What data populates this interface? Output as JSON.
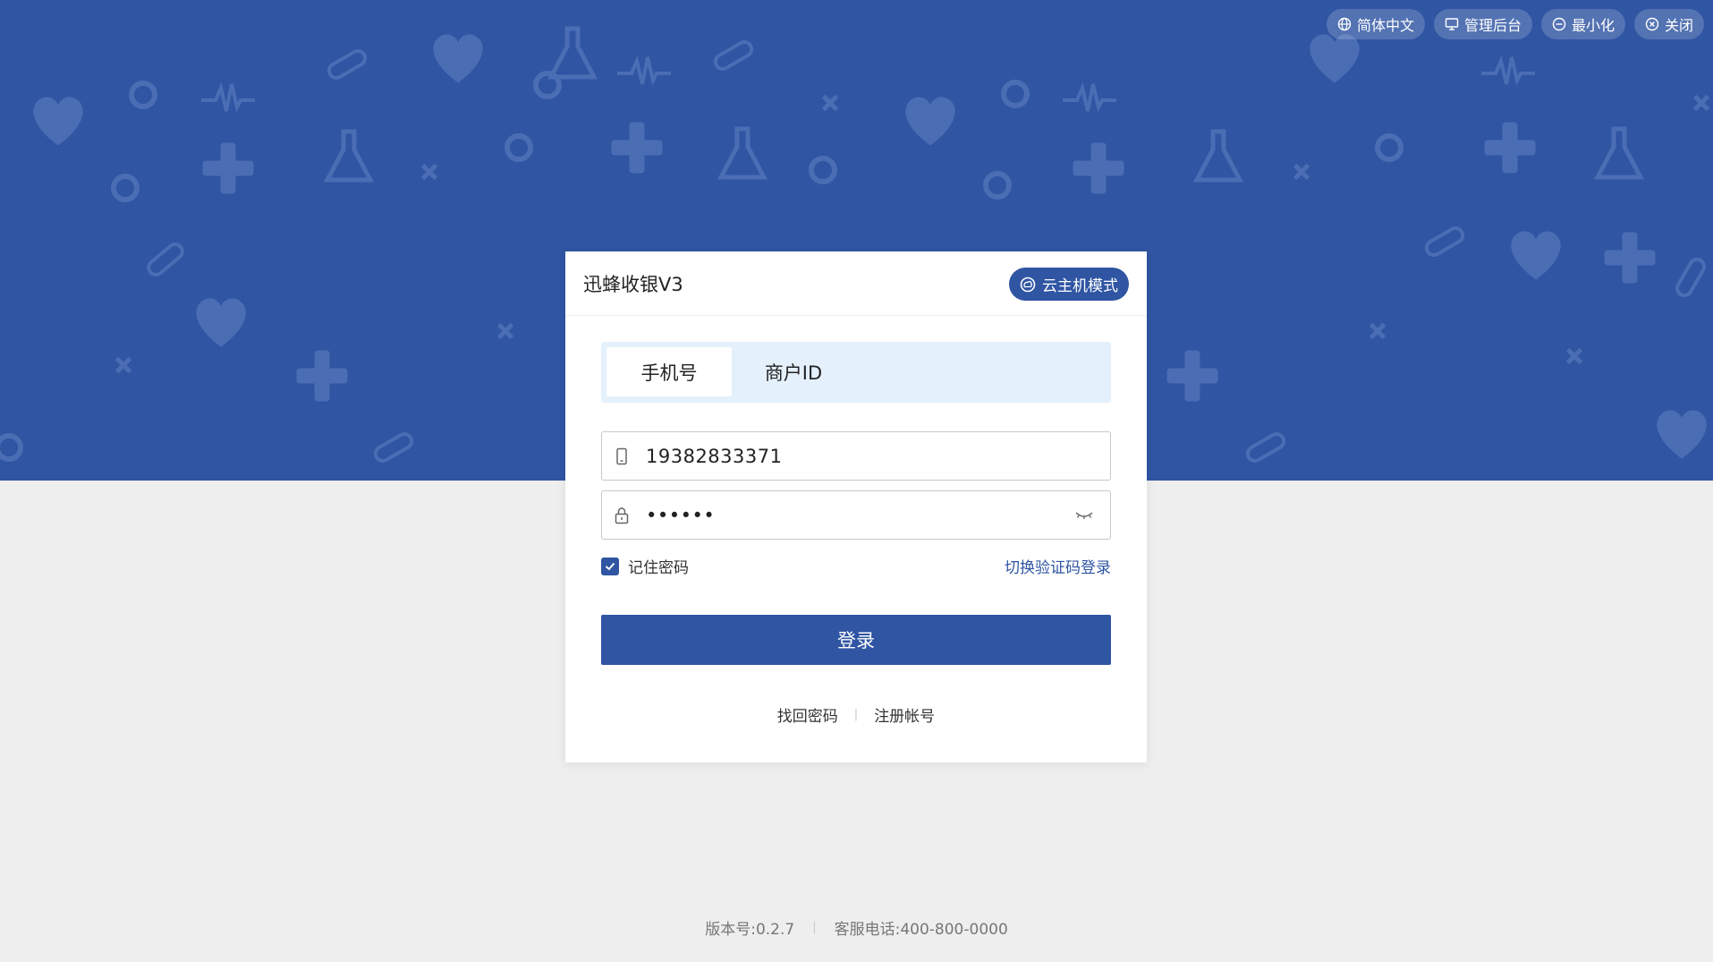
{
  "topbar": {
    "language": "简体中文",
    "admin": "管理后台",
    "minimize": "最小化",
    "close": "关闭"
  },
  "card": {
    "title": "迅蜂收银V3",
    "mode": "云主机模式"
  },
  "tabs": [
    {
      "label": "手机号",
      "active": true
    },
    {
      "label": "商户ID",
      "active": false
    }
  ],
  "form": {
    "phone_value": "19382833371",
    "password_value": "••••••",
    "remember_label": "记住密码",
    "remember_checked": true,
    "switch_login": "切换验证码登录",
    "login_button": "登录"
  },
  "links": {
    "forgot": "找回密码",
    "register": "注册帐号"
  },
  "footer": {
    "version": "版本号:0.2.7",
    "phone": "客服电话:400-800-0000"
  },
  "colors": {
    "primary": "#2f55a3",
    "tab_bg": "#e4f0fb",
    "page_bg": "#eeeeee"
  }
}
